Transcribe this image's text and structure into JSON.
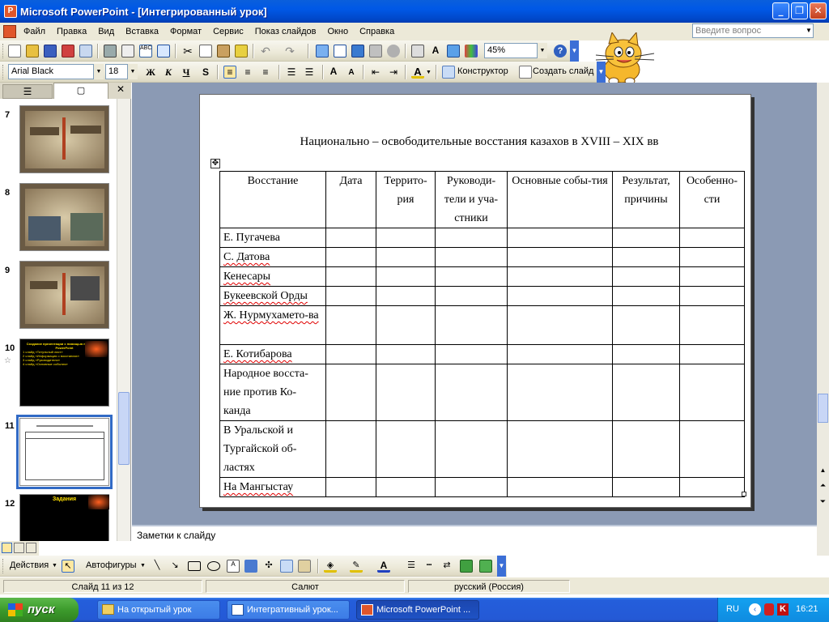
{
  "window": {
    "title": "Microsoft PowerPoint - [Интегрированный урок]"
  },
  "menu": [
    "Файл",
    "Правка",
    "Вид",
    "Вставка",
    "Формат",
    "Сервис",
    "Показ слайдов",
    "Окно",
    "Справка"
  ],
  "help_box": {
    "placeholder": "Введите вопрос"
  },
  "toolbar": {
    "zoom": "45%",
    "font": "Arial Black",
    "size": "18",
    "bold": "Ж",
    "italic": "К",
    "underline": "Ч",
    "shadow": "S",
    "designer": "Конструктор",
    "new_slide": "Создать слайд"
  },
  "thumbnails": [
    {
      "num": "7",
      "style": "brown"
    },
    {
      "num": "8",
      "style": "brown"
    },
    {
      "num": "9",
      "style": "brown"
    },
    {
      "num": "10",
      "style": "black",
      "lines": [
        "Создание презентации с помощью программы PowerPoint",
        "1 слайд «Титульный лист»",
        "2 слайд «Информация о восстаниях»",
        "3 слайд «Руководители»",
        "4 слайд «Основные события»"
      ]
    },
    {
      "num": "11",
      "style": "white",
      "selected": true
    },
    {
      "num": "12",
      "style": "black",
      "lines": [
        "Задания"
      ]
    }
  ],
  "slide": {
    "title": "Национально – освободительные восстания казахов в XVIII – XIX вв",
    "table_headers": [
      "Восстание",
      "Дата",
      "Террито-рия",
      "Руководи-тели и уча-стники",
      "Основные собы-тия",
      "Результат, причины",
      "Особенно-сти"
    ],
    "table_rows": [
      "Е. Пугачева",
      "С. Датова",
      "Кенесары",
      "Букеевской Орды",
      "Ж. Нурмухамето-ва",
      "Е. Котибарова",
      "Народное восста-ние против Ко-канда",
      "В Уральской и Тургайской об-ластях",
      "На Мангыстау"
    ]
  },
  "notes": {
    "placeholder": "Заметки к слайду"
  },
  "drawing_toolbar": {
    "actions": "Действия",
    "autoshapes": "Автофигуры"
  },
  "status": {
    "slide": "Слайд 11 из 12",
    "design": "Салют",
    "language": "русский (Россия)"
  },
  "taskbar": {
    "start": "пуск",
    "tasks": [
      "На открытый урок",
      "Интегративный урок...",
      "Microsoft PowerPoint ..."
    ],
    "lang": "RU",
    "clock": "16:21"
  },
  "colors": {
    "titlebar": "#0058e6",
    "workspace": "#8b9ab4",
    "taskbar": "#245edb"
  }
}
